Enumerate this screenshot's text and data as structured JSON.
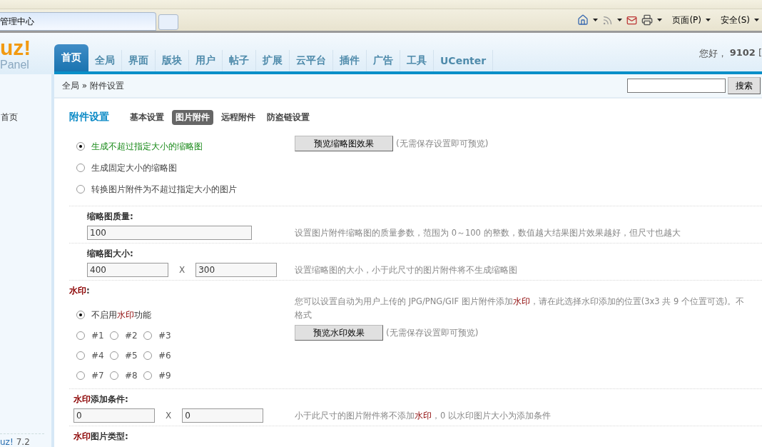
{
  "browser": {
    "tab_title": "管理中心",
    "menus": [
      {
        "label": "页面(P)"
      },
      {
        "label": "安全(S)"
      }
    ]
  },
  "header": {
    "logo": "uz!",
    "logo_sub": "Panel",
    "nav": [
      {
        "label": "首页",
        "selected": true
      },
      {
        "label": "全局",
        "selected": false
      },
      {
        "label": "界面",
        "selected": false
      },
      {
        "label": "版块",
        "selected": false
      },
      {
        "label": "用户",
        "selected": false
      },
      {
        "label": "帖子",
        "selected": false
      },
      {
        "label": "扩展",
        "selected": false
      },
      {
        "label": "云平台",
        "selected": false
      },
      {
        "label": "插件",
        "selected": false
      },
      {
        "label": "广告",
        "selected": false
      },
      {
        "label": "工具",
        "selected": false
      },
      {
        "label": "UCenter",
        "selected": false
      }
    ],
    "greeting": "您好，",
    "user": "9102",
    "bracket": "[",
    "breadcrumb": "全局 » 附件设置",
    "search_button": "搜索"
  },
  "sidebar": {
    "items": [
      {
        "label": "首页"
      }
    ],
    "footer_brand": "uz!",
    "footer_version": "7.2"
  },
  "page": {
    "title": "附件设置",
    "subtabs": [
      {
        "label": "基本设置",
        "selected": false
      },
      {
        "label": "图片附件",
        "selected": true
      },
      {
        "label": "远程附件",
        "selected": false
      },
      {
        "label": "防盗链设置",
        "selected": false
      }
    ],
    "thumbnail": {
      "options": [
        {
          "label": "生成不超过指定大小的缩略图",
          "selected": true
        },
        {
          "label": "生成固定大小的缩略图",
          "selected": false
        },
        {
          "label": "转换图片附件为不超过指定大小的图片",
          "selected": false
        }
      ],
      "button": "预览缩略图效果",
      "note": "(无需保存设置即可预览)",
      "settings": [
        {
          "kind": "single",
          "label": [
            {
              "text": "缩略图质量:",
              "highlight": false
            }
          ],
          "values": [
            "100"
          ],
          "description": [
            {
              "text": "设置图片附件缩略图的质量参数，范围为 0～100 的整数，数值越大结果图片效果越好，但尺寸也越大",
              "highlight": false
            }
          ]
        },
        {
          "kind": "pair",
          "label": [
            {
              "text": "缩略图大小:",
              "highlight": false
            }
          ],
          "values": [
            "400",
            "300"
          ],
          "separator": "X",
          "description": [
            {
              "text": "设置缩略图的大小，小于此尺寸的图片附件将不生成缩略图",
              "highlight": false
            }
          ]
        }
      ]
    },
    "watermark": {
      "label": [
        {
          "text": "水印",
          "highlight": true
        },
        {
          "text": ":",
          "highlight": false
        }
      ],
      "off_option": {
        "label": [
          {
            "text": "不启用",
            "highlight": false
          },
          {
            "text": "水印",
            "highlight": true
          },
          {
            "text": "功能",
            "highlight": false
          }
        ],
        "selected": true
      },
      "positions": [
        {
          "label": "#1",
          "selected": false
        },
        {
          "label": "#2",
          "selected": false
        },
        {
          "label": "#3",
          "selected": false
        },
        {
          "label": "#4",
          "selected": false
        },
        {
          "label": "#5",
          "selected": false
        },
        {
          "label": "#6",
          "selected": false
        },
        {
          "label": "#7",
          "selected": false
        },
        {
          "label": "#8",
          "selected": false
        },
        {
          "label": "#9",
          "selected": false
        }
      ],
      "description_lines": [
        [
          {
            "text": "您可以设置自动为用户上传的 JPG/PNG/GIF 图片附件添加",
            "highlight": false
          },
          {
            "text": "水印",
            "highlight": true
          },
          {
            "text": "，请在此选择水印添加的位置(3x3 共 9 个位置可选)。不",
            "highlight": false
          }
        ],
        [
          {
            "text": "格式",
            "highlight": false
          }
        ]
      ],
      "button": "预览水印效果",
      "note": "(无需保存设置即可预览)",
      "settings": [
        {
          "kind": "pair",
          "label": [
            {
              "text": "水印",
              "highlight": true
            },
            {
              "text": "添加条件:",
              "highlight": false
            }
          ],
          "values": [
            "0",
            "0"
          ],
          "separator": "X",
          "description": [
            {
              "text": "小于此尺寸的图片附件将不添加",
              "highlight": false
            },
            {
              "text": "水印",
              "highlight": true
            },
            {
              "text": "，0 以水印图片大小为添加条件",
              "highlight": false
            }
          ]
        },
        {
          "kind": "heading",
          "label": [
            {
              "text": "水印",
              "highlight": true
            },
            {
              "text": "图片类型:",
              "highlight": false
            }
          ]
        }
      ]
    }
  }
}
